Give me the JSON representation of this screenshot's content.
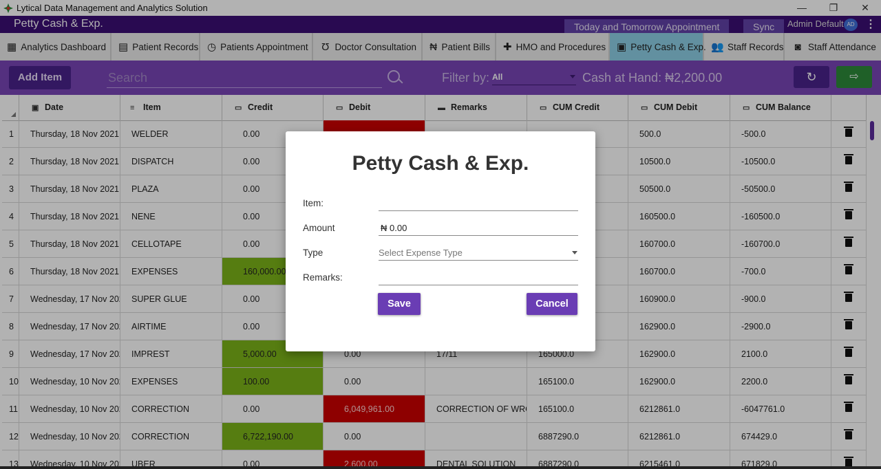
{
  "window": {
    "title": "Lytical Data Management and Analytics Solution",
    "controls": [
      "—",
      "❐",
      "✕"
    ]
  },
  "appbar": {
    "title": "Petty Cash & Exp.",
    "appointments_label": "Today and Tomorrow Appointment",
    "sync_label": "Sync",
    "user_name": "Admin Default",
    "avatar_initials": "AD"
  },
  "tabs": [
    {
      "label": "Analytics Dashboard",
      "icon": "dashboard-icon",
      "active": false
    },
    {
      "label": "Patient Records",
      "icon": "clipboard-icon",
      "active": false
    },
    {
      "label": "Patients Appointment",
      "icon": "calendar-clock-icon",
      "active": false
    },
    {
      "label": "Doctor Consultation",
      "icon": "stethoscope-icon",
      "active": false
    },
    {
      "label": "Patient Bills",
      "icon": "naira-icon",
      "active": false
    },
    {
      "label": "HMO and Procedures",
      "icon": "medical-bag-icon",
      "active": false
    },
    {
      "label": "Petty Cash & Exp.",
      "icon": "cash-icon",
      "active": true
    },
    {
      "label": "Staff Records",
      "icon": "people-icon",
      "active": false
    },
    {
      "label": "Staff Attendance",
      "icon": "attendance-icon",
      "active": false
    }
  ],
  "toolbar": {
    "add_label": "Add Item",
    "search_placeholder": "Search",
    "filter_label": "Filter by:",
    "filter_value": "All",
    "cash_at_hand": "Cash at Hand: ₦2,200.00"
  },
  "table": {
    "columns": [
      "Date",
      "Item",
      "Credit",
      "Debit",
      "Remarks",
      "CUM Credit",
      "CUM Debit",
      "CUM Balance"
    ],
    "rows": [
      {
        "n": "1",
        "date": "Thursday, 18 Nov 2021",
        "item": "WELDER",
        "credit": "0.00",
        "debit": "",
        "remarks": "",
        "cum_credit": "",
        "cum_debit": "500.0",
        "cum_balance": "-500.0",
        "credit_hl": "",
        "debit_hl": "red"
      },
      {
        "n": "2",
        "date": "Thursday, 18 Nov 2021",
        "item": "DISPATCH",
        "credit": "0.00",
        "debit": "",
        "remarks": "",
        "cum_credit": "",
        "cum_debit": "10500.0",
        "cum_balance": "-10500.0",
        "credit_hl": "",
        "debit_hl": ""
      },
      {
        "n": "3",
        "date": "Thursday, 18 Nov 2021",
        "item": "PLAZA",
        "credit": "0.00",
        "debit": "",
        "remarks": "",
        "cum_credit": "",
        "cum_debit": "50500.0",
        "cum_balance": "-50500.0",
        "credit_hl": "",
        "debit_hl": ""
      },
      {
        "n": "4",
        "date": "Thursday, 18 Nov 2021",
        "item": "NENE",
        "credit": "0.00",
        "debit": "",
        "remarks": "",
        "cum_credit": "",
        "cum_debit": "160500.0",
        "cum_balance": "-160500.0",
        "credit_hl": "",
        "debit_hl": ""
      },
      {
        "n": "5",
        "date": "Thursday, 18 Nov 2021",
        "item": "CELLOTAPE",
        "credit": "0.00",
        "debit": "",
        "remarks": "",
        "cum_credit": "",
        "cum_debit": "160700.0",
        "cum_balance": "-160700.0",
        "credit_hl": "",
        "debit_hl": ""
      },
      {
        "n": "6",
        "date": "Thursday, 18 Nov 2021",
        "item": "EXPENSES",
        "credit": "160,000.00",
        "debit": "",
        "remarks": "",
        "cum_credit": "",
        "cum_debit": "160700.0",
        "cum_balance": "-700.0",
        "credit_hl": "green",
        "debit_hl": ""
      },
      {
        "n": "7",
        "date": "Wednesday, 17 Nov 202",
        "item": "SUPER GLUE",
        "credit": "0.00",
        "debit": "",
        "remarks": "",
        "cum_credit": "",
        "cum_debit": "160900.0",
        "cum_balance": "-900.0",
        "credit_hl": "",
        "debit_hl": ""
      },
      {
        "n": "8",
        "date": "Wednesday, 17 Nov 202",
        "item": "AIRTIME",
        "credit": "0.00",
        "debit": "",
        "remarks": "",
        "cum_credit": "",
        "cum_debit": "162900.0",
        "cum_balance": "-2900.0",
        "credit_hl": "",
        "debit_hl": ""
      },
      {
        "n": "9",
        "date": "Wednesday, 17 Nov 202",
        "item": "IMPREST",
        "credit": "5,000.00",
        "debit": "0.00",
        "remarks": "17/11",
        "cum_credit": "165000.0",
        "cum_debit": "162900.0",
        "cum_balance": "2100.0",
        "credit_hl": "green",
        "debit_hl": ""
      },
      {
        "n": "10",
        "date": "Wednesday, 10 Nov 202",
        "item": "EXPENSES",
        "credit": "100.00",
        "debit": "0.00",
        "remarks": "",
        "cum_credit": "165100.0",
        "cum_debit": "162900.0",
        "cum_balance": "2200.0",
        "credit_hl": "green",
        "debit_hl": ""
      },
      {
        "n": "11",
        "date": "Wednesday, 10 Nov 202",
        "item": "CORRECTION",
        "credit": "0.00",
        "debit": "6,049,961.00",
        "remarks": "CORRECTION OF WRON",
        "cum_credit": "165100.0",
        "cum_debit": "6212861.0",
        "cum_balance": "-6047761.0",
        "credit_hl": "",
        "debit_hl": "red"
      },
      {
        "n": "12",
        "date": "Wednesday, 10 Nov 202",
        "item": "CORRECTION",
        "credit": "6,722,190.00",
        "debit": "0.00",
        "remarks": "",
        "cum_credit": "6887290.0",
        "cum_debit": "6212861.0",
        "cum_balance": "674429.0",
        "credit_hl": "green",
        "debit_hl": ""
      },
      {
        "n": "13",
        "date": "Wednesday, 10 Nov 202",
        "item": "UBER",
        "credit": "0.00",
        "debit": "2,600.00",
        "remarks": "DENTAL SOLUTION",
        "cum_credit": "6887290.0",
        "cum_debit": "6215461.0",
        "cum_balance": "671829.0",
        "credit_hl": "",
        "debit_hl": "red"
      }
    ]
  },
  "dialog": {
    "title": "Petty Cash & Exp.",
    "item_label": "Item:",
    "item_value": "",
    "amount_label": "Amount",
    "amount_currency": "₦",
    "amount_value": "0.00",
    "type_label": "Type",
    "type_placeholder": "Select Expense Type",
    "remarks_label": "Remarks:",
    "remarks_value": "",
    "save_label": "Save",
    "cancel_label": "Cancel"
  },
  "colors": {
    "header_purple": "#3b0f74",
    "toolbar_purple": "#7946b6",
    "active_tab": "#8dcfe5",
    "credit_green": "#7cb319",
    "debit_red": "#cc0000",
    "button_purple": "#6a3db4"
  }
}
